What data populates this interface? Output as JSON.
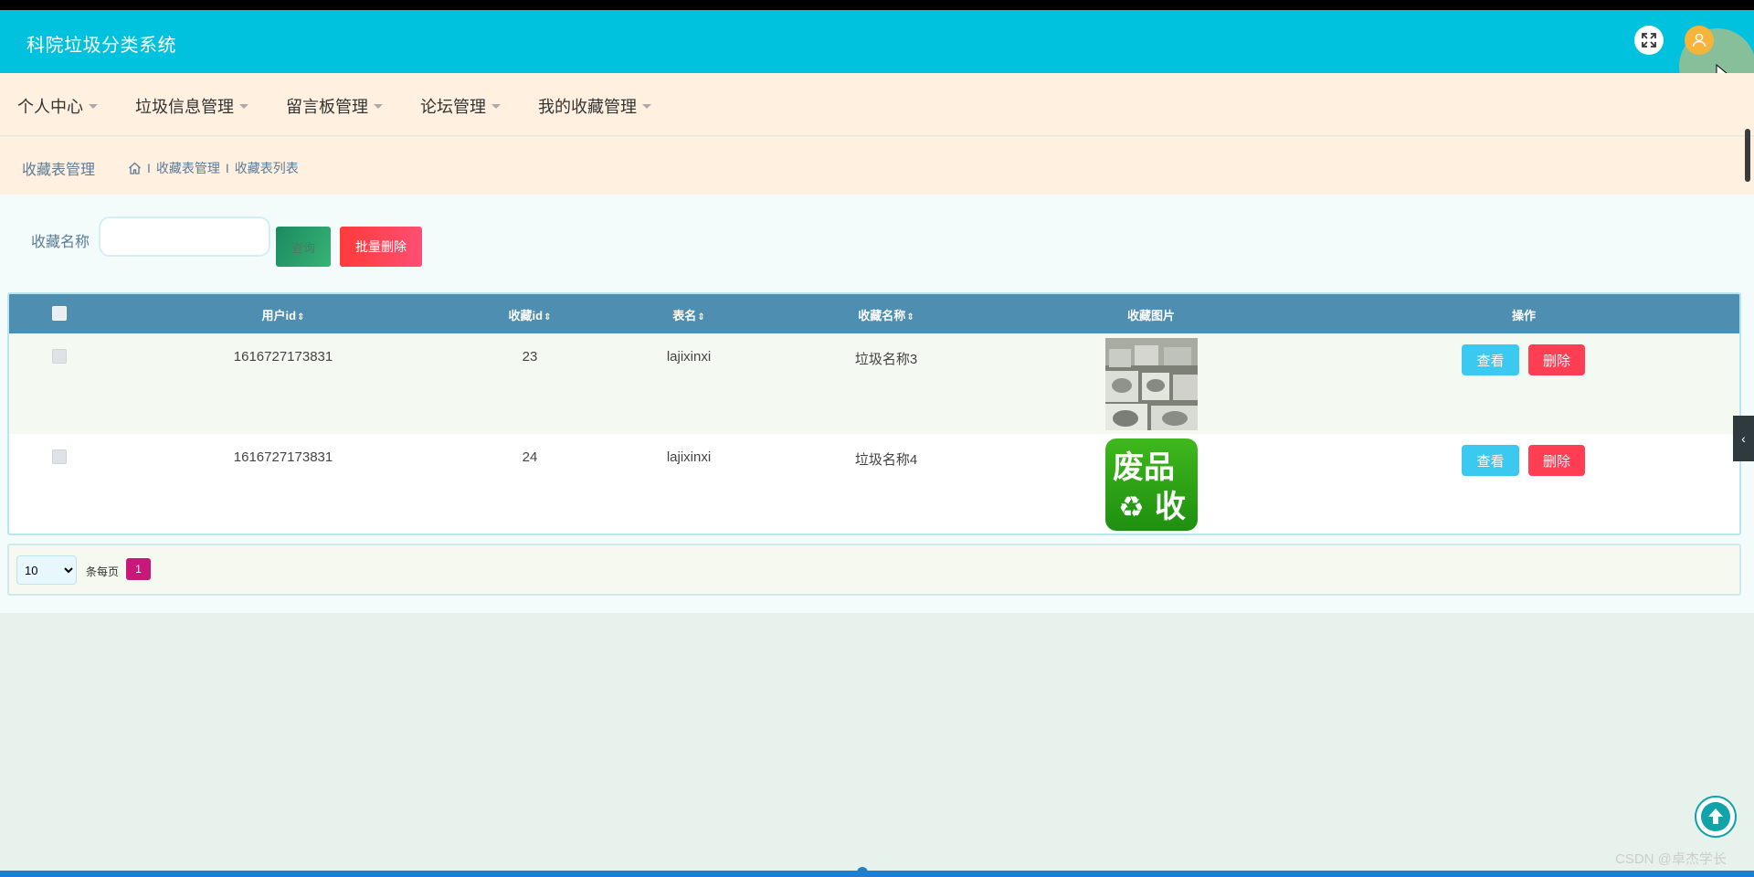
{
  "header": {
    "title": "科院垃圾分类系统",
    "expand_icon": "expand-icon",
    "user_icon": "user-icon"
  },
  "nav": {
    "items": [
      {
        "label": "个人中心"
      },
      {
        "label": "垃圾信息管理"
      },
      {
        "label": "留言板管理"
      },
      {
        "label": "论坛管理"
      },
      {
        "label": "我的收藏管理"
      }
    ]
  },
  "breadcrumb": {
    "page_title": "收藏表管理",
    "items": [
      "收藏表管理",
      "收藏表列表"
    ]
  },
  "search": {
    "label": "收藏名称",
    "value": "",
    "query_label": "查询",
    "batch_delete_label": "批量删除"
  },
  "table": {
    "headers": {
      "userid": "用户id",
      "collect_id": "收藏id",
      "table_name": "表名",
      "collect_name": "收藏名称",
      "collect_image": "收藏图片",
      "actions": "操作"
    },
    "rows": [
      {
        "userid": "1616727173831",
        "collect_id": "23",
        "table_name": "lajixinxi",
        "collect_name": "垃圾名称3",
        "view": "查看",
        "delete": "删除"
      },
      {
        "userid": "1616727173831",
        "collect_id": "24",
        "table_name": "lajixinxi",
        "collect_name": "垃圾名称4",
        "view": "查看",
        "delete": "删除"
      }
    ],
    "logo_text": {
      "top": "废品",
      "bottom": "收"
    }
  },
  "pagination": {
    "page_size": "10",
    "page_size_options": [
      "10"
    ],
    "per_page_label": "条每页",
    "current_page": "1"
  },
  "watermark": "CSDN @卓杰学长",
  "colors": {
    "header_bg": "#00c2de",
    "nav_bg": "#fff0e0",
    "table_header_bg": "#4e8eb0",
    "view_button": "#3cc9f0",
    "delete_button": "#ff3d53",
    "page_active": "#c8197a"
  }
}
